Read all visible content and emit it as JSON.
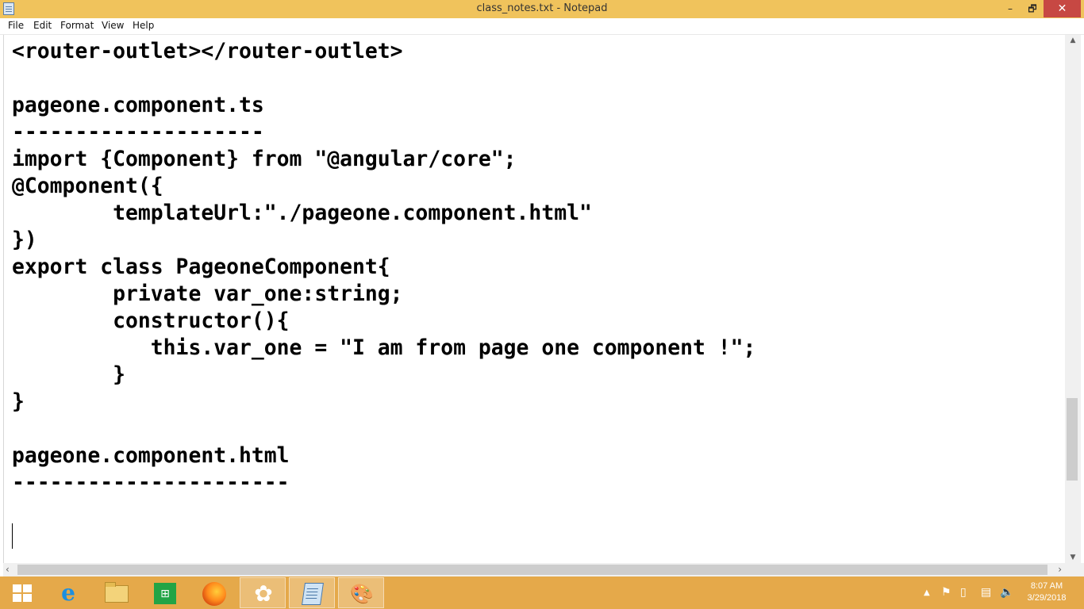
{
  "window": {
    "title": "class_notes.txt - Notepad",
    "controls": {
      "minimize": "–",
      "maximize": "🗗",
      "close": "✕"
    }
  },
  "menu": {
    "file": "File",
    "edit": "Edit",
    "format": "Format",
    "view": "View",
    "help": "Help"
  },
  "editor": {
    "content": "<router-outlet></router-outlet>\n\npageone.component.ts\n--------------------\nimport {Component} from \"@angular/core\";\n@Component({\n        templateUrl:\"./pageone.component.html\"\n})\nexport class PageoneComponent{\n        private var_one:string;\n        constructor(){\n           this.var_one = \"I am from page one component !\";\n        }\n}\n\npageone.component.html\n----------------------\n"
  },
  "taskbar": {
    "items": [
      "windows-start-icon",
      "internet-explorer-icon",
      "file-explorer-icon",
      "windows-store-icon",
      "firefox-icon",
      "flower-app-icon",
      "notepad-icon",
      "paint-icon"
    ],
    "active_item": "notepad-icon",
    "clock_time": "8:07 AM",
    "clock_date": "3/29/2018",
    "background_color": "#e5a94a"
  },
  "colors": {
    "titlebar": "#f0c35c",
    "close_button": "#c74843"
  }
}
